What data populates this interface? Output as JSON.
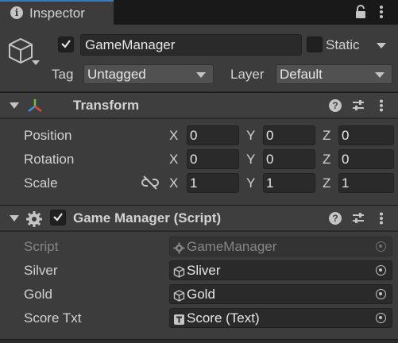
{
  "tab": {
    "title": "Inspector"
  },
  "game_object": {
    "active": true,
    "name": "GameManager",
    "static_checked": false,
    "static_label": "Static",
    "tag_label": "Tag",
    "tag_value": "Untagged",
    "layer_label": "Layer",
    "layer_value": "Default"
  },
  "transform": {
    "title": "Transform",
    "rows": [
      {
        "label": "Position",
        "x": "0",
        "y": "0",
        "z": "0"
      },
      {
        "label": "Rotation",
        "x": "0",
        "y": "0",
        "z": "0"
      },
      {
        "label": "Scale",
        "x": "1",
        "y": "1",
        "z": "1"
      }
    ],
    "axis_labels": {
      "x": "X",
      "y": "Y",
      "z": "Z"
    }
  },
  "script_component": {
    "title": "Game Manager (Script)",
    "enabled": true,
    "fields": [
      {
        "label": "Script",
        "value": "GameManager",
        "icon": "script-icon",
        "disabled": true
      },
      {
        "label": "Silver",
        "value": "Sliver",
        "icon": "cube-icon",
        "disabled": false
      },
      {
        "label": "Gold",
        "value": "Gold",
        "icon": "cube-icon",
        "disabled": false
      },
      {
        "label": "Score Txt",
        "value": "Score (Text)",
        "icon": "text-component-icon",
        "disabled": false
      }
    ]
  },
  "colors": {
    "panel": "#3c3c3c",
    "field": "#2a2a2a",
    "accent_tab": "#3a79bb"
  }
}
